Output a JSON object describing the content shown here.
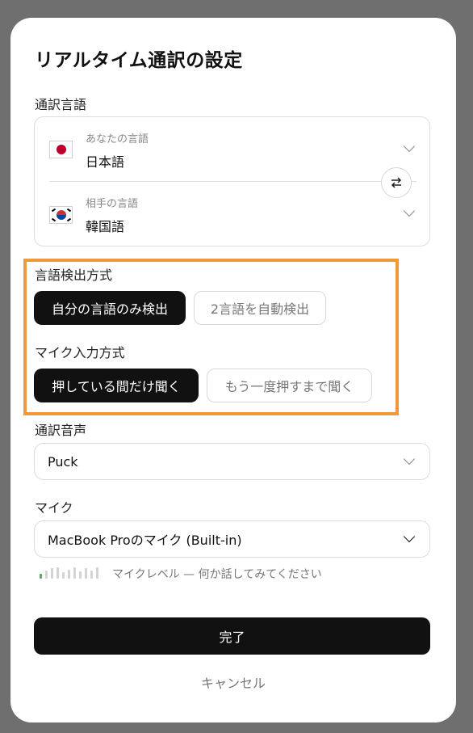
{
  "dialog": {
    "title": "リアルタイム通訳の設定"
  },
  "translation_languages": {
    "label": "通訳言語",
    "your_language": {
      "caption": "あなたの言語",
      "value": "日本語",
      "flag_icon": "japan-flag-icon"
    },
    "partner_language": {
      "caption": "相手の言語",
      "value": "韓国語",
      "flag_icon": "korea-flag-icon"
    },
    "swap_icon": "swap-arrows-icon"
  },
  "detection_mode": {
    "label": "言語検出方式",
    "options": [
      "自分の言語のみ検出",
      "2言語を自動検出"
    ],
    "selected": 0
  },
  "mic_input_mode": {
    "label": "マイク入力方式",
    "options": [
      "押している間だけ聞く",
      "もう一度押すまで聞く"
    ],
    "selected": 0
  },
  "voice": {
    "label": "通訳音声",
    "value": "Puck"
  },
  "mic": {
    "label": "マイク",
    "value": "MacBook Proのマイク (Built-in)",
    "level_text": "マイクレベル — 何か話してみてください",
    "level_fraction": 0.1
  },
  "actions": {
    "done_label": "完了",
    "cancel_label": "キャンセル"
  },
  "colors": {
    "highlight": "#f0993a",
    "primary": "#111111",
    "meter_active": "#3cb46e"
  }
}
